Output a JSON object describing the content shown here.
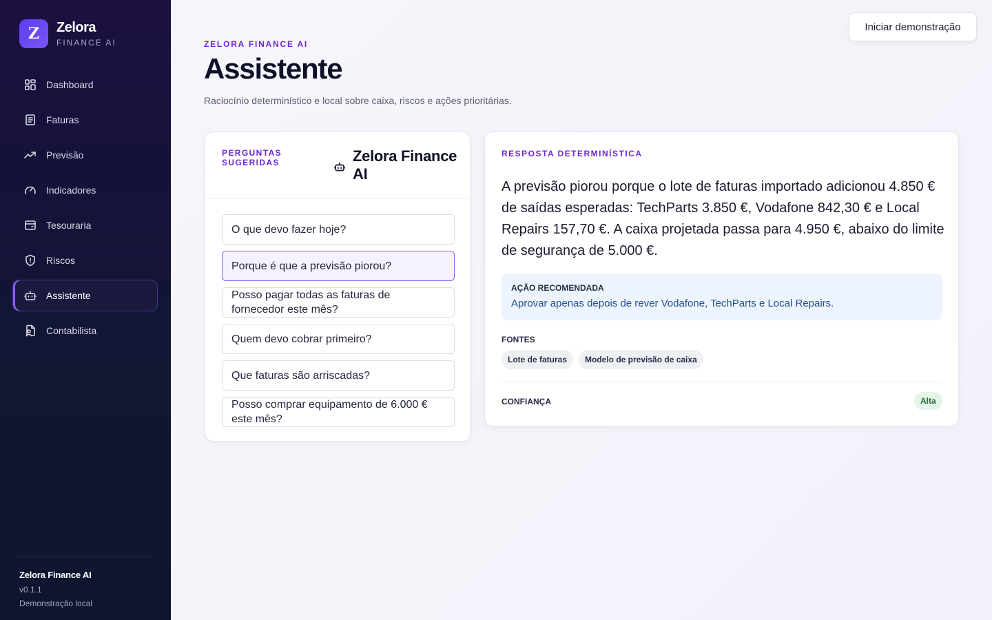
{
  "brand": {
    "name": "Zelora",
    "subtitle": "FINANCE AI",
    "logo_letter": "Z"
  },
  "sidebar": {
    "items": [
      {
        "label": "Dashboard",
        "icon": "grid-icon",
        "active": false
      },
      {
        "label": "Faturas",
        "icon": "document-icon",
        "active": false
      },
      {
        "label": "Previsão",
        "icon": "trend-up-icon",
        "active": false
      },
      {
        "label": "Indicadores",
        "icon": "gauge-icon",
        "active": false
      },
      {
        "label": "Tesouraria",
        "icon": "wallet-icon",
        "active": false
      },
      {
        "label": "Riscos",
        "icon": "shield-icon",
        "active": false
      },
      {
        "label": "Assistente",
        "icon": "bot-icon",
        "active": true
      },
      {
        "label": "Contabilista",
        "icon": "file-user-icon",
        "active": false
      }
    ],
    "footer": {
      "title": "Zelora Finance AI",
      "version": "v0.1.1",
      "mode": "Demonstração local"
    }
  },
  "header": {
    "demo_button": "Iniciar demonstração",
    "eyebrow": "ZELORA FINANCE AI",
    "title": "Assistente",
    "subtitle": "Raciocínio determinístico e local sobre caixa, riscos e ações prioritárias."
  },
  "questions": {
    "label": "PERGUNTAS SUGERIDAS",
    "title": "Zelora Finance AI",
    "items": [
      {
        "text": "O que devo fazer hoje?",
        "selected": false
      },
      {
        "text": "Porque é que a previsão piorou?",
        "selected": true
      },
      {
        "text": "Posso pagar todas as faturas de fornecedor este mês?",
        "selected": false
      },
      {
        "text": "Quem devo cobrar primeiro?",
        "selected": false
      },
      {
        "text": "Que faturas são arriscadas?",
        "selected": false
      },
      {
        "text": "Posso comprar equipamento de 6.000 € este mês?",
        "selected": false
      }
    ]
  },
  "answer": {
    "label": "RESPOSTA DETERMINÍSTICA",
    "text": "A previsão piorou porque o lote de faturas importado adicionou 4.850 € de saídas esperadas: TechParts 3.850 €, Vodafone 842,30 € e Local Repairs 157,70 €. A caixa projetada passa para 4.950 €, abaixo do limite de segurança de 5.000 €.",
    "recommendation": {
      "title": "AÇÃO RECOMENDADA",
      "text": "Aprovar apenas depois de rever Vodafone, TechParts e Local Repairs."
    },
    "sources_label": "FONTES",
    "sources": [
      "Lote de faturas",
      "Modelo de previsão de caixa"
    ],
    "confidence_label": "CONFIANÇA",
    "confidence_value": "Alta"
  },
  "colors": {
    "accent": "#6d28d9",
    "active_border": "#8b5cf6",
    "sidebar_bg": "#111633"
  }
}
